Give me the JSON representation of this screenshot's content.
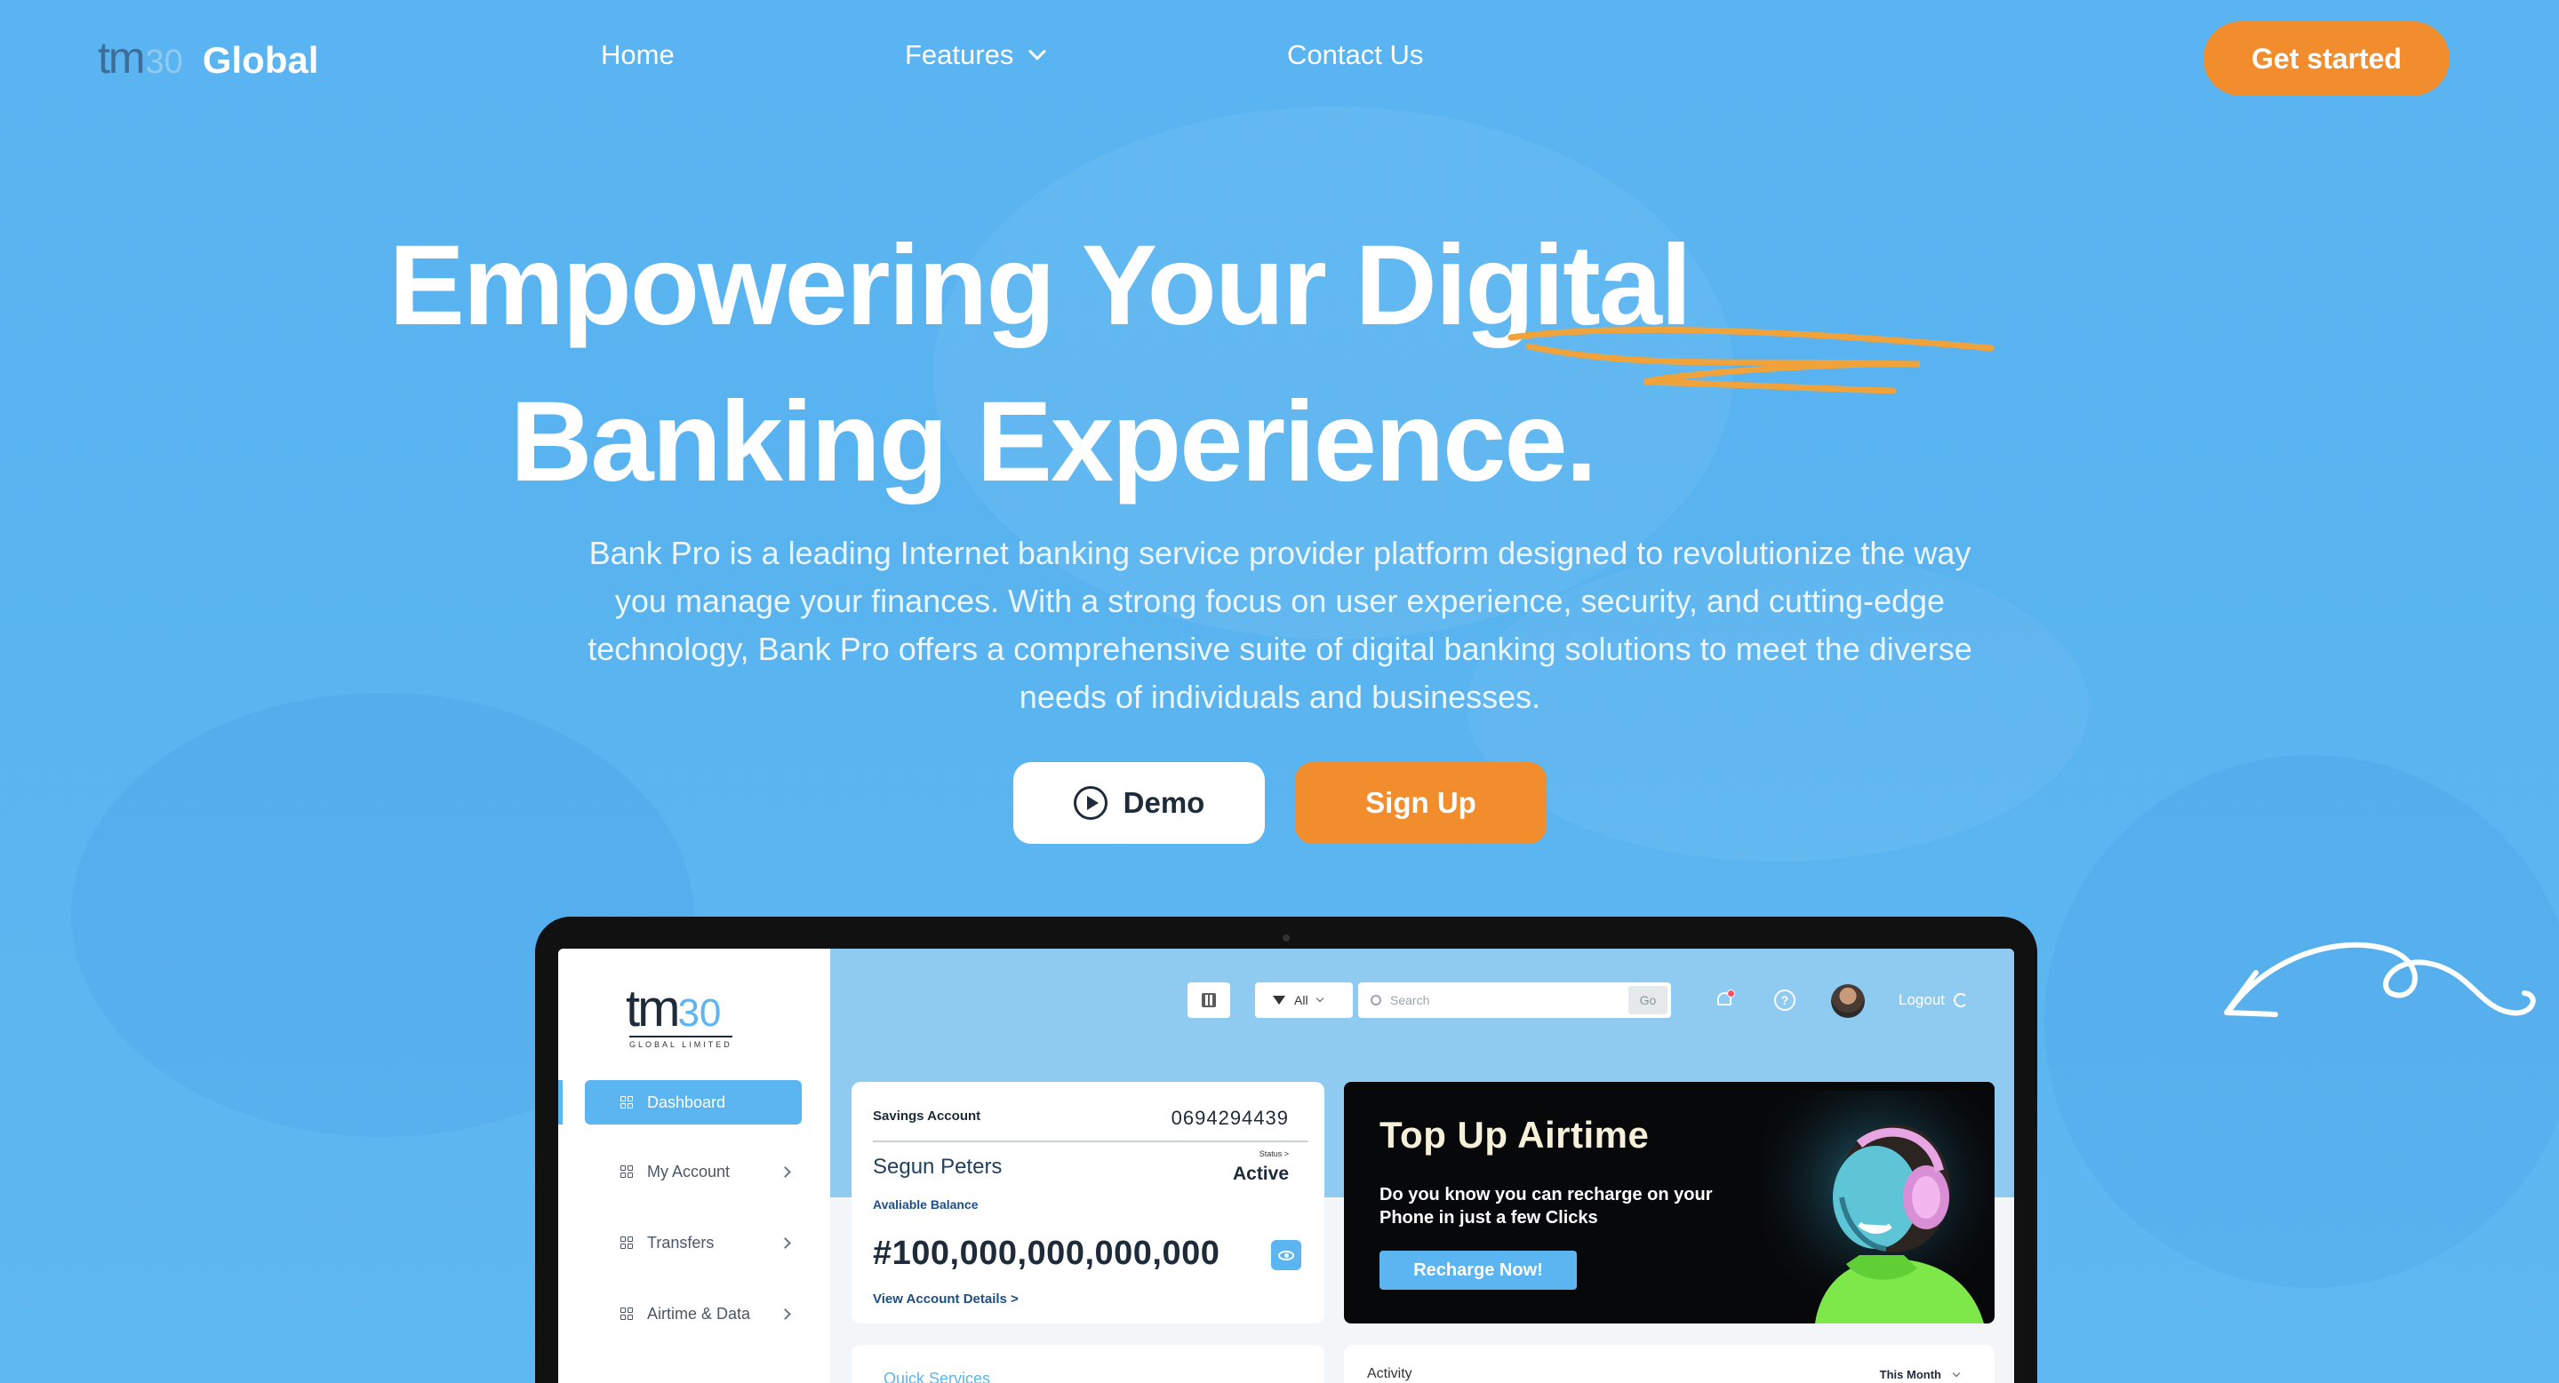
{
  "brand": {
    "logo_tm": "tm",
    "logo_num": "30",
    "name": "Global"
  },
  "nav": {
    "home": "Home",
    "features": "Features",
    "contact": "Contact Us",
    "cta": "Get started"
  },
  "hero": {
    "title_line1": "Empowering Your Digital",
    "title_line2": "Banking Experience.",
    "description": "Bank Pro is a leading Internet banking service provider platform designed to revolutionize the way you manage your finances. With a strong focus on user experience, security, and cutting-edge technology, Bank Pro offers a comprehensive suite of digital banking solutions to meet the diverse needs of individuals and businesses.",
    "demo_label": "Demo",
    "signup_label": "Sign Up"
  },
  "app": {
    "logo_tm": "tm",
    "logo_num": "30",
    "logo_sub": "GLOBAL LIMITED",
    "sidebar": [
      {
        "label": "Dashboard"
      },
      {
        "label": "My Account"
      },
      {
        "label": "Transfers"
      },
      {
        "label": "Airtime & Data"
      }
    ],
    "toolbar": {
      "filter": "All",
      "search_placeholder": "Search",
      "search_go": "Go",
      "help": "?",
      "logout": "Logout"
    },
    "account": {
      "type": "Savings Account",
      "number": "0694294439",
      "name": "Segun Peters",
      "status_label": "Status >",
      "status": "Active",
      "balance_label": "Avaliable Balance",
      "balance": "#100,000,000,000,000",
      "view_link": "View Account Details >"
    },
    "promo": {
      "title": "Top Up Airtime",
      "text": "Do you know you can recharge on your Phone in just a few Clicks",
      "button": "Recharge Now!"
    },
    "quick_services": "Quick Services",
    "activity": {
      "label": "Activity",
      "period": "This Month"
    }
  },
  "colors": {
    "background": "#5ab4f1",
    "accent": "#f18d2d",
    "app_primary": "#5bb5f0"
  }
}
